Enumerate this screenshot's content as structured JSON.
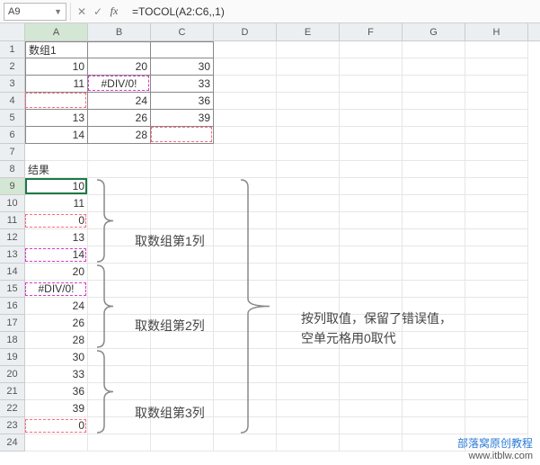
{
  "formula_bar": {
    "cell_ref": "A9",
    "cancel": "✕",
    "confirm": "✓",
    "fx": "fx",
    "formula": "=TOCOL(A2:C6,,1)"
  },
  "columns": [
    "A",
    "B",
    "C",
    "D",
    "E",
    "F",
    "G",
    "H"
  ],
  "rows_count": 24,
  "arr_label": "数组1",
  "result_label": "结果",
  "array1": {
    "A": [
      "10",
      "11",
      "",
      "13",
      "14"
    ],
    "B": [
      "20",
      "#DIV/0!",
      "24",
      "26",
      "28"
    ],
    "C": [
      "30",
      "33",
      "36",
      "39",
      ""
    ]
  },
  "result": [
    "10",
    "11",
    "0",
    "13",
    "14",
    "20",
    "#DIV/0!",
    "24",
    "26",
    "28",
    "30",
    "33",
    "36",
    "39",
    "0"
  ],
  "annotations": {
    "col1": "取数组第1列",
    "col2": "取数组第2列",
    "col3": "取数组第3列",
    "main1": "按列取值，保留了错误值，",
    "main2": "空单元格用0取代"
  },
  "footer": {
    "title": "部落窝原创教程",
    "url": "www.itblw.com"
  },
  "chart_data": {
    "type": "table",
    "title": "TOCOL function demo",
    "input_range": "A2:C6",
    "formula": "=TOCOL(A2:C6,,1)",
    "input": [
      [
        10,
        20,
        30
      ],
      [
        11,
        "#DIV/0!",
        33
      ],
      [
        null,
        24,
        36
      ],
      [
        13,
        26,
        39
      ],
      [
        14,
        28,
        null
      ]
    ],
    "output": [
      10,
      11,
      0,
      13,
      14,
      20,
      "#DIV/0!",
      24,
      26,
      28,
      30,
      33,
      36,
      39,
      0
    ],
    "note": "按列取值，保留了错误值，空单元格用0取代"
  }
}
